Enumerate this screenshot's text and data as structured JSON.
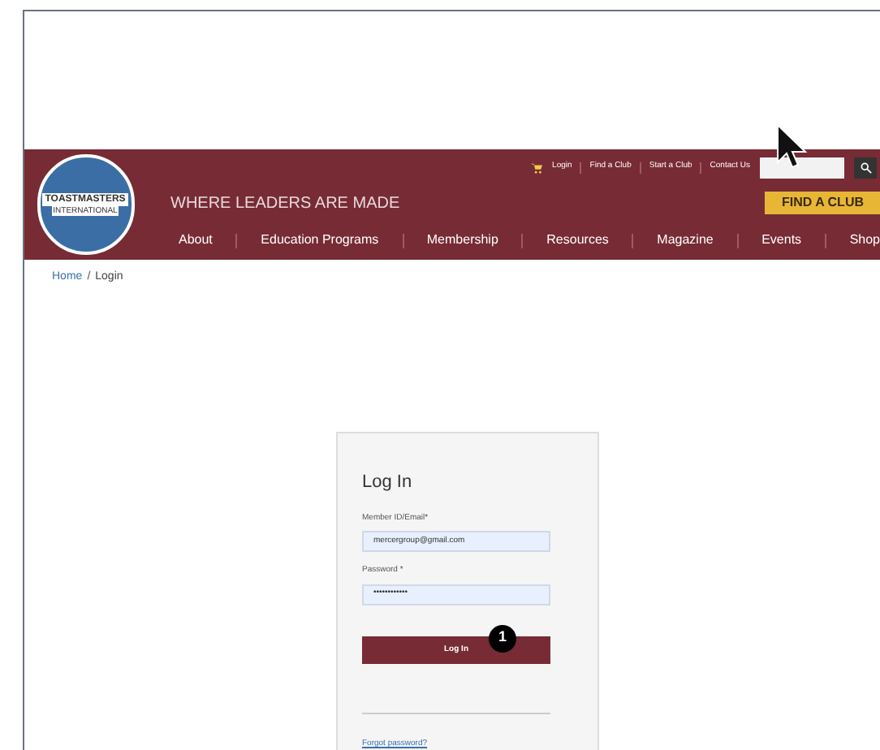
{
  "header": {
    "logo_text": "TOASTMASTERS",
    "logo_subtext": "INTERNATIONAL",
    "tagline": "WHERE LEADERS ARE MADE",
    "utility_links": [
      "Login",
      "Find a Club",
      "Start a Club",
      "Contact Us"
    ],
    "cta": "FIND A CLUB",
    "nav": [
      "About",
      "Education Programs",
      "Membership",
      "Resources",
      "Magazine",
      "Events",
      "Shop"
    ]
  },
  "breadcrumb": [
    "Home",
    "/",
    "Login"
  ],
  "login": {
    "title": "Log In",
    "fields": [
      {
        "label": "Member ID/Email*",
        "value": "mercergroup@gmail.com"
      },
      {
        "label": "Password *",
        "value": "••••••••••••"
      }
    ],
    "button": "Log In",
    "step_badge": "1",
    "forgot": "Forgot password?"
  }
}
